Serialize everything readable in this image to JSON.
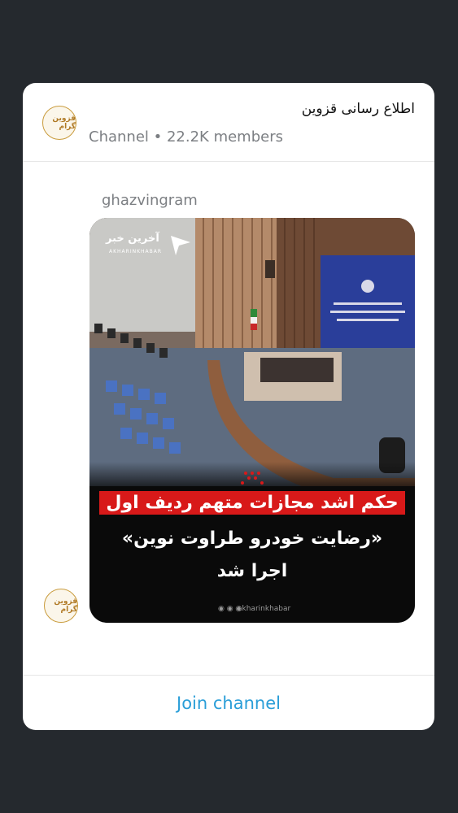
{
  "channel": {
    "title": "اطلاع رسانی قزوین",
    "meta": "Channel • 22.2K members",
    "logo_text": "قزوین گرام"
  },
  "post": {
    "author": "ghazvingram",
    "image": {
      "watermark": "آخرین خبر",
      "watermark_sub": "AKHARINKHABAR",
      "headline_line1": "حکم اشد مجازات متهم ردیف اول",
      "headline_line2": "«رضایت خودرو طراوت نوین»",
      "headline_line3": "اجرا شد",
      "social_icons": "◉ ◉ ◉",
      "social_handle": "akharinkhabar"
    }
  },
  "footer": {
    "join_label": "Join channel"
  },
  "colors": {
    "background": "#25292e",
    "accent": "#2a9ed8",
    "headline_red": "#d81919"
  }
}
